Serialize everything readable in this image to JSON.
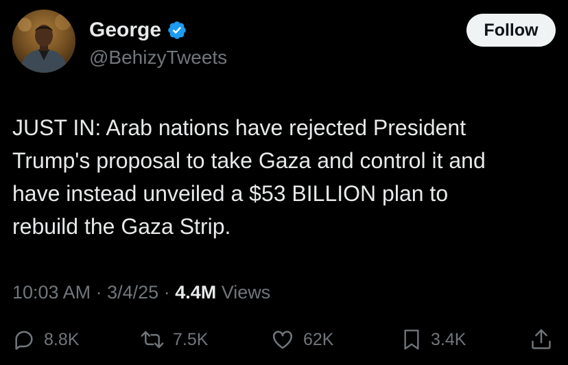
{
  "author": {
    "display_name": "George",
    "handle": "@BehizyTweets",
    "verified": true,
    "verified_color": "#1d9bf0",
    "avatar_icon": "profile-photo"
  },
  "follow_button": {
    "label": "Follow"
  },
  "tweet": {
    "text_lines": [
      "JUST IN: Arab nations have rejected President",
      "Trump's proposal to take Gaza and control it and",
      "have instead unveiled a $53 BILLION plan to",
      "rebuild the Gaza Strip."
    ],
    "time": "10:03 AM",
    "separator": "·",
    "date": "3/4/25",
    "views_count": "4.4M",
    "views_label": "Views"
  },
  "actions": {
    "replies": {
      "icon": "reply-icon",
      "count": "8.8K"
    },
    "reposts": {
      "icon": "repost-icon",
      "count": "7.5K"
    },
    "likes": {
      "icon": "heart-icon",
      "count": "62K"
    },
    "bookmarks": {
      "icon": "bookmark-icon",
      "count": "3.4K"
    },
    "share": {
      "icon": "share-icon"
    }
  },
  "colors": {
    "background": "#000000",
    "text_primary": "#e7e9ea",
    "text_secondary": "#71767b",
    "follow_bg": "#eff3f4"
  }
}
